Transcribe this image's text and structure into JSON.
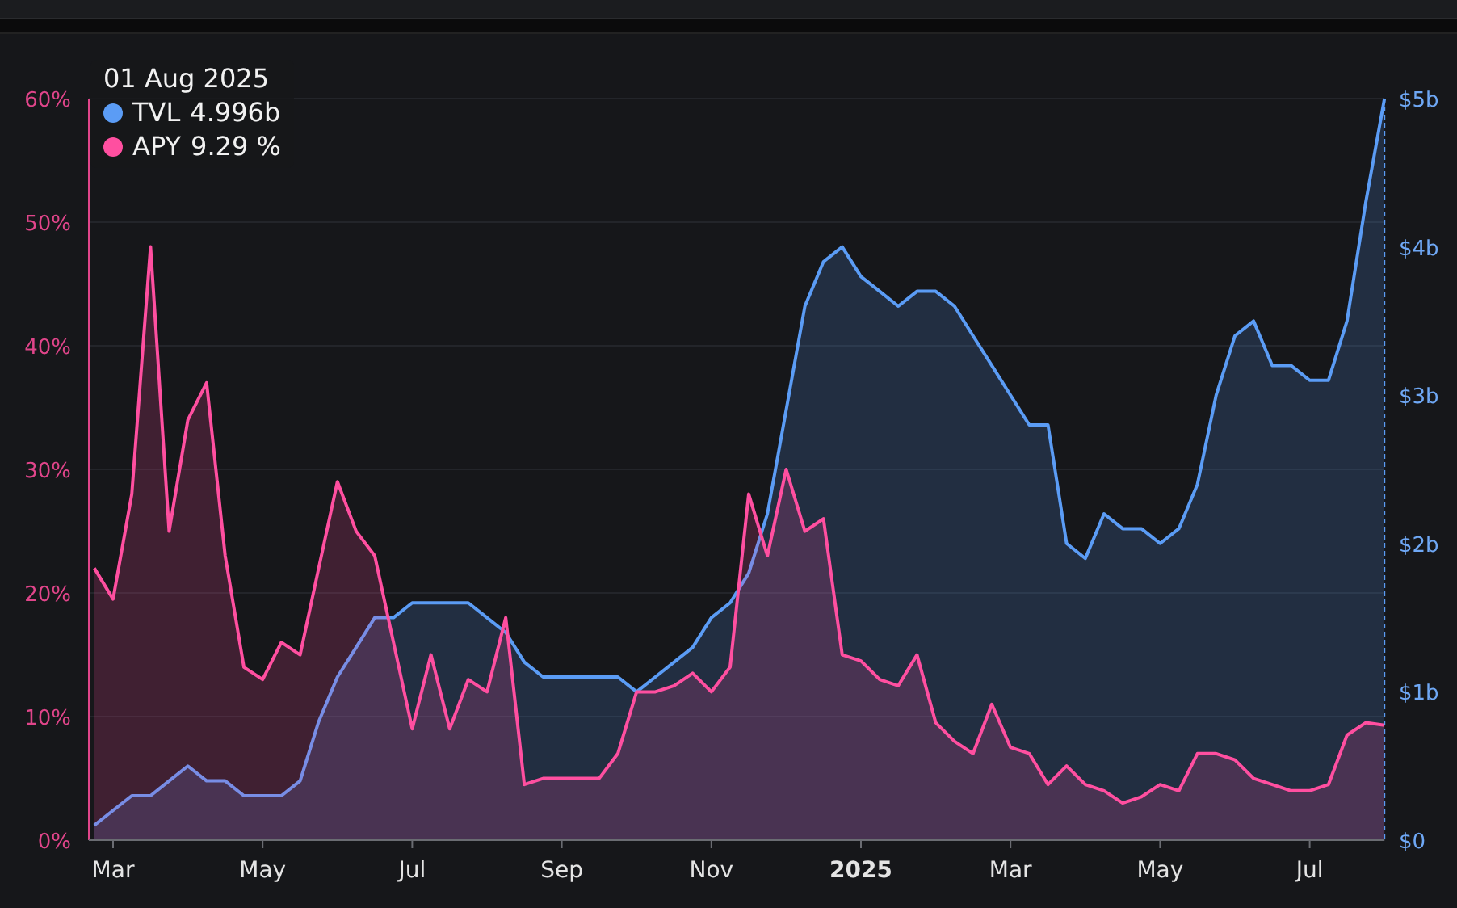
{
  "chart": {
    "tooltip": {
      "date": "01 Aug 2025",
      "values": [
        "4.996b",
        "9.29 %"
      ]
    },
    "chart_data": {
      "type": "area",
      "grid": true,
      "categories": [
        null,
        "Mar",
        null,
        null,
        null,
        null,
        null,
        null,
        null,
        "May",
        null,
        null,
        null,
        null,
        null,
        null,
        null,
        "Jul",
        null,
        null,
        null,
        null,
        null,
        null,
        null,
        "Sep",
        null,
        null,
        null,
        null,
        null,
        null,
        null,
        "Nov",
        null,
        null,
        null,
        null,
        null,
        null,
        null,
        "2025",
        null,
        null,
        null,
        null,
        null,
        null,
        null,
        "Mar",
        null,
        null,
        null,
        null,
        null,
        null,
        null,
        "May",
        null,
        null,
        null,
        null,
        null,
        null,
        null,
        "Jul",
        null,
        null,
        null,
        null
      ],
      "series": [
        {
          "name": "TVL",
          "color": "#5b9cf5",
          "axis": "y2",
          "values": [
            0.1,
            0.2,
            0.3,
            0.3,
            0.4,
            0.5,
            0.4,
            0.4,
            0.3,
            0.3,
            0.3,
            0.4,
            0.8,
            1.1,
            1.3,
            1.5,
            1.5,
            1.6,
            1.6,
            1.6,
            1.6,
            1.5,
            1.4,
            1.2,
            1.1,
            1.1,
            1.1,
            1.1,
            1.1,
            1.0,
            1.1,
            1.2,
            1.3,
            1.5,
            1.6,
            1.8,
            2.2,
            2.9,
            3.6,
            3.9,
            4.0,
            3.8,
            3.7,
            3.6,
            3.7,
            3.7,
            3.6,
            3.4,
            3.2,
            3.0,
            2.8,
            2.8,
            2.0,
            1.9,
            2.2,
            2.1,
            2.1,
            2.0,
            2.1,
            2.4,
            3.0,
            3.4,
            3.5,
            3.2,
            3.2,
            3.1,
            3.1,
            3.5,
            4.3,
            5.0
          ]
        },
        {
          "name": "APY",
          "color": "#ff4fa0",
          "values": [
            22,
            19.5,
            28,
            48,
            25,
            34,
            37,
            23,
            14,
            13,
            16,
            15,
            22,
            29,
            25,
            23,
            16,
            9,
            15,
            9,
            13,
            12,
            18,
            4.5,
            5,
            5,
            5,
            5,
            7,
            12,
            12,
            12.5,
            13.5,
            12,
            14,
            28,
            23,
            30,
            25,
            26,
            15,
            14.5,
            13,
            12.5,
            15,
            9.5,
            8,
            7,
            11,
            7.5,
            7,
            4.5,
            6,
            4.5,
            4,
            3,
            3.5,
            4.5,
            4,
            7,
            7,
            6.5,
            5,
            4.5,
            4,
            4,
            4.5,
            8.5,
            9.5,
            9.3
          ]
        }
      ],
      "ylim": [
        0,
        60
      ],
      "yticks": [
        {
          "value": 0,
          "label": "0%"
        },
        {
          "value": 10,
          "label": "10%"
        },
        {
          "value": 20,
          "label": "20%"
        },
        {
          "value": 30,
          "label": "30%"
        },
        {
          "value": 40,
          "label": "40%"
        },
        {
          "value": 50,
          "label": "50%"
        },
        {
          "value": 60,
          "label": "60%"
        }
      ],
      "y2lim": [
        0,
        5
      ],
      "y2ticks": [
        {
          "value": 0,
          "label": "$0"
        },
        {
          "value": 1,
          "label": "$1b"
        },
        {
          "value": 2,
          "label": "$2b"
        },
        {
          "value": 3,
          "label": "$3b"
        },
        {
          "value": 4,
          "label": "$4b"
        },
        {
          "value": 5,
          "label": "$5b"
        }
      ]
    }
  }
}
